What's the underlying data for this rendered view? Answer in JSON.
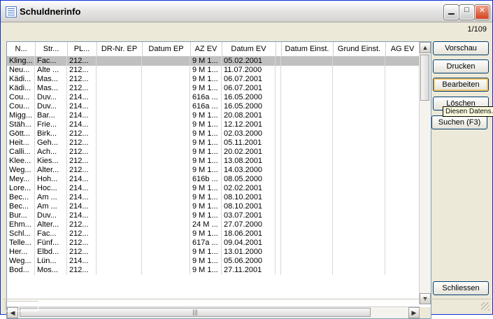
{
  "window": {
    "title": "Schuldnerinfo"
  },
  "titlebar_buttons": [
    {
      "name": "minimize-button",
      "glyph": "▁"
    },
    {
      "name": "maximize-button",
      "glyph": "□"
    },
    {
      "name": "close-button",
      "glyph": "✕"
    }
  ],
  "record_counter": "1/109",
  "grid": {
    "headers": [
      "N...",
      "Str...",
      "PL...",
      "DR-Nr. EP",
      "Datum EP",
      "AZ EV",
      "Datum EV",
      "",
      "Datum Einst.",
      "Grund Einst.",
      "AG EV"
    ],
    "rows": [
      [
        "Kling...",
        "Fac...",
        "212...",
        "",
        "",
        "9 M 1...",
        "05.02.2001",
        "",
        "",
        "",
        ""
      ],
      [
        "Neu...",
        "Alte ...",
        "212...",
        "",
        "",
        "9 M 1...",
        "11.07.2000",
        "",
        "",
        "",
        ""
      ],
      [
        "Kädi...",
        "Mas...",
        "212...",
        "",
        "",
        "9 M 1...",
        "06.07.2001",
        "",
        "",
        "",
        ""
      ],
      [
        "Kädi...",
        "Mas...",
        "212...",
        "",
        "",
        "9 M 1...",
        "06.07.2001",
        "",
        "",
        "",
        ""
      ],
      [
        "Cou...",
        "Duv...",
        "214...",
        "",
        "",
        "616a ...",
        "16.05.2000",
        "",
        "",
        "",
        ""
      ],
      [
        "Cou...",
        "Duv...",
        "214...",
        "",
        "",
        "616a ...",
        "16.05.2000",
        "",
        "",
        "",
        ""
      ],
      [
        "Migg...",
        "Bar...",
        "214...",
        "",
        "",
        "9 M 1...",
        "20.08.2001",
        "",
        "",
        "",
        ""
      ],
      [
        "Stäh...",
        "Frie...",
        "214...",
        "",
        "",
        "9 M 1...",
        "12.12.2001",
        "",
        "",
        "",
        ""
      ],
      [
        "Gött...",
        "Birk...",
        "212...",
        "",
        "",
        "9 M 1...",
        "02.03.2000",
        "",
        "",
        "",
        ""
      ],
      [
        "Heit...",
        "Geh...",
        "212...",
        "",
        "",
        "9 M 1...",
        "05.11.2001",
        "",
        "",
        "",
        ""
      ],
      [
        "Calli...",
        "Ach...",
        "212...",
        "",
        "",
        "9 M 1...",
        "20.02.2001",
        "",
        "",
        "",
        ""
      ],
      [
        "Klee...",
        "Kies...",
        "212...",
        "",
        "",
        "9 M 1...",
        "13.08.2001",
        "",
        "",
        "",
        ""
      ],
      [
        "Weg...",
        "Alter...",
        "212...",
        "",
        "",
        "9 M 1...",
        "14.03.2000",
        "",
        "",
        "",
        ""
      ],
      [
        "Mey...",
        "Hoh...",
        "214...",
        "",
        "",
        "616b ...",
        "08.05.2000",
        "",
        "",
        "",
        ""
      ],
      [
        "Lore...",
        "Hoc...",
        "214...",
        "",
        "",
        "9 M 1...",
        "02.02.2001",
        "",
        "",
        "",
        ""
      ],
      [
        "Bec...",
        "Am ...",
        "214...",
        "",
        "",
        "9 M 1...",
        "08.10.2001",
        "",
        "",
        "",
        ""
      ],
      [
        "Bec...",
        "Am ...",
        "214...",
        "",
        "",
        "9 M 1...",
        "08.10.2001",
        "",
        "",
        "",
        ""
      ],
      [
        "Bur...",
        "Duv...",
        "214...",
        "",
        "",
        "9 M 1...",
        "03.07.2001",
        "",
        "",
        "",
        ""
      ],
      [
        "Ehm...",
        "Alter...",
        "212...",
        "",
        "",
        "24 M ...",
        "27.07.2000",
        "",
        "",
        "",
        ""
      ],
      [
        "Schl...",
        "Fac...",
        "212...",
        "",
        "",
        "9 M 1...",
        "18.06.2001",
        "",
        "",
        "",
        ""
      ],
      [
        "Telle...",
        "Fünf...",
        "212...",
        "",
        "",
        "617a ...",
        "09.04.2001",
        "",
        "",
        "",
        ""
      ],
      [
        "Her...",
        "Elbd...",
        "212...",
        "",
        "",
        "9 M 1...",
        "13.01.2000",
        "",
        "",
        "",
        ""
      ],
      [
        "Weg...",
        "Lün...",
        "214...",
        "",
        "",
        "9 M 1...",
        "05.06.2000",
        "",
        "",
        "",
        ""
      ],
      [
        "Bod...",
        "Mos...",
        "212...",
        "",
        "",
        "9 M 1...",
        "27.11.2001",
        "",
        "",
        "",
        ""
      ]
    ]
  },
  "buttons": {
    "vorschau": "Vorschau",
    "drucken": "Drucken",
    "bearbeiten": "Bearbeiten",
    "loeschen": "Löschen",
    "suchen": "Suchen (F3)",
    "schliessen": "Schliessen"
  },
  "tooltip": "Diesen Datens..."
}
